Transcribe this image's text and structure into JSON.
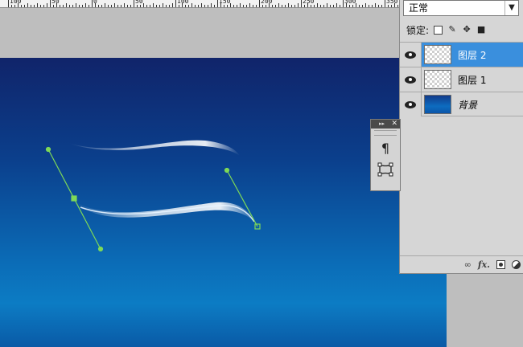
{
  "ruler": {
    "labels": [
      "100",
      "50",
      "0",
      "50",
      "100",
      "150",
      "200",
      "250",
      "300",
      "350",
      "400"
    ]
  },
  "layers_panel": {
    "blend_mode": "正常",
    "lock_label": "锁定:",
    "layers": [
      {
        "name": "图层 2",
        "selected": true,
        "type": "transparent"
      },
      {
        "name": "图层 1",
        "selected": false,
        "type": "transparent"
      },
      {
        "name": "背景",
        "selected": false,
        "type": "background"
      }
    ],
    "bottom_icons": [
      "link-icon",
      "fx-icon",
      "mask-icon",
      "adjustment-icon"
    ],
    "fx_label": "fx."
  },
  "mini_panel": {
    "tools": [
      "paragraph-icon",
      "transform-icon"
    ],
    "paragraph_glyph": "¶"
  },
  "colors": {
    "selection": "#3a8fdd",
    "path_handles": "#7ed957",
    "canvas_top": "#10246a",
    "canvas_bottom": "#0c7cc4"
  }
}
